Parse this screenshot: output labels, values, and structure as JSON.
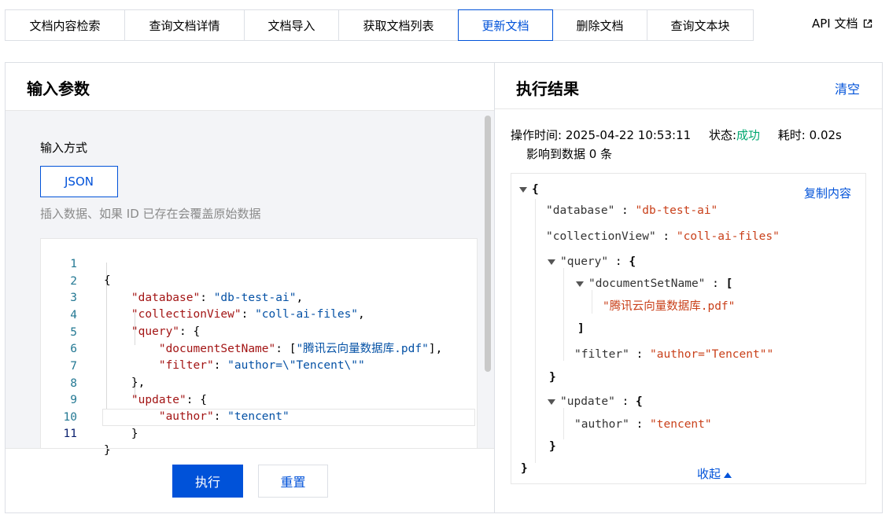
{
  "tabs": [
    {
      "label": "文档内容检索",
      "active": false
    },
    {
      "label": "查询文档详情",
      "active": false
    },
    {
      "label": "文档导入",
      "active": false
    },
    {
      "label": "获取文档列表",
      "active": false
    },
    {
      "label": "更新文档",
      "active": true
    },
    {
      "label": "删除文档",
      "active": false
    },
    {
      "label": "查询文本块",
      "active": false
    }
  ],
  "api_doc": {
    "label": "API 文档",
    "icon": "external-link-icon"
  },
  "left": {
    "title": "输入参数",
    "input_mode_label": "输入方式",
    "mode_button": "JSON",
    "hint": "插入数据、如果 ID 已存在会覆盖原始数据",
    "code_lines": [
      "{",
      "    \"database\": \"db-test-ai\",",
      "    \"collectionView\": \"coll-ai-files\",",
      "    \"query\": {",
      "        \"documentSetName\": [\"腾讯云向量数据库.pdf\"],",
      "        \"filter\": \"author=\\\"Tencent\\\"\"",
      "    },",
      "    \"update\": {",
      "        \"author\": \"tencent\"",
      "    }",
      "}"
    ],
    "line_numbers": [
      "1",
      "2",
      "3",
      "4",
      "5",
      "6",
      "7",
      "8",
      "9",
      "10",
      "11"
    ],
    "execute_label": "执行",
    "reset_label": "重置"
  },
  "right": {
    "title": "执行结果",
    "clear_label": "清空",
    "meta": {
      "time_label": "操作时间:",
      "time_value": "2025-04-22 10:53:11",
      "status_label": "状态:",
      "status_value": "成功",
      "duration_label": "耗时:",
      "duration_value": "0.02s",
      "affected": "影响到数据 0 条"
    },
    "copy_label": "复制内容",
    "collapse_label": "收起",
    "result": {
      "database_key": "\"database\"",
      "database_val": "\"db-test-ai\"",
      "collection_key": "\"collectionView\"",
      "collection_val": "\"coll-ai-files\"",
      "query_key": "\"query\"",
      "docset_key": "\"documentSetName\"",
      "docset_val": "\"腾讯云向量数据库.pdf\"",
      "filter_key": "\"filter\"",
      "filter_val": "\"author=\"Tencent\"\"",
      "update_key": "\"update\"",
      "author_key": "\"author\"",
      "author_val": "\"tencent\""
    }
  },
  "colors": {
    "accent": "#0052d9",
    "success": "#00a870",
    "string": "#c9401a"
  }
}
